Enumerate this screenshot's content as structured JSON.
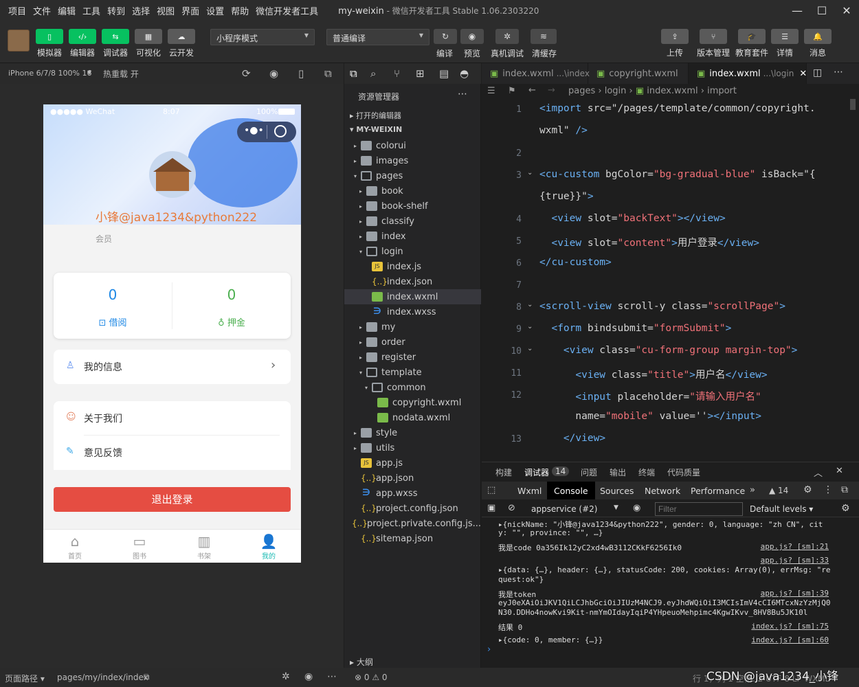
{
  "menu": [
    "项目",
    "文件",
    "编辑",
    "工具",
    "转到",
    "选择",
    "视图",
    "界面",
    "设置",
    "帮助",
    "微信开发者工具"
  ],
  "window": {
    "project": "my-weixin",
    "title": " - 微信开发者工具 Stable 1.06.2303220",
    "min": "—",
    "max": "☐",
    "close": "✕"
  },
  "toolbar": {
    "left_buttons": [
      {
        "label": "模拟器",
        "glyph": "▯"
      },
      {
        "label": "编辑器",
        "glyph": "‹/›"
      },
      {
        "label": "调试器",
        "glyph": "⇆"
      },
      {
        "label": "可视化",
        "glyph": "▦"
      },
      {
        "label": "云开发",
        "glyph": "☁"
      }
    ],
    "mode": "小程序模式",
    "compile": "普通编译",
    "mid_labels": [
      "编译",
      "预览",
      "真机调试",
      "清缓存"
    ],
    "mid_glyphs": [
      "↻",
      "◉",
      "✲",
      "≋"
    ],
    "right_buttons": [
      {
        "label": "上传",
        "glyph": "⇪"
      },
      {
        "label": "版本管理",
        "glyph": "⑂"
      },
      {
        "label": "教育套件",
        "glyph": "🎓"
      },
      {
        "label": "详情",
        "glyph": "☰"
      },
      {
        "label": "消息",
        "glyph": "🔔"
      }
    ]
  },
  "sim": {
    "device": "iPhone 6/7/8 100% 16",
    "reload": "热重载 开"
  },
  "phone": {
    "carrier": "●●●●● WeChat",
    "time": "8:07",
    "battery": "100%",
    "username": "小锋@java1234&python222",
    "role": "会员",
    "stats": [
      {
        "value": "0",
        "label": "借阅",
        "color": "#1e88e5"
      },
      {
        "value": "0",
        "label": "押金",
        "color": "#4caf50"
      }
    ],
    "my_info": "我的信息",
    "about": "关于我们",
    "feedback": "意见反馈",
    "logout": "退出登录",
    "nav": [
      {
        "label": "首页",
        "icon": "⌂"
      },
      {
        "label": "图书",
        "icon": "▭"
      },
      {
        "label": "书架",
        "icon": "▥"
      },
      {
        "label": "我的",
        "icon": "👤"
      }
    ]
  },
  "explorer": {
    "title": "资源管理器",
    "open_editors": "打开的编辑器",
    "root": "MY-WEIXIN",
    "items": [
      {
        "name": "colorui",
        "level": 1,
        "type": "folder"
      },
      {
        "name": "images",
        "level": 1,
        "type": "folder"
      },
      {
        "name": "pages",
        "level": 1,
        "type": "folder-open"
      },
      {
        "name": "book",
        "level": 2,
        "type": "folder"
      },
      {
        "name": "book-shelf",
        "level": 2,
        "type": "folder"
      },
      {
        "name": "classify",
        "level": 2,
        "type": "folder"
      },
      {
        "name": "index",
        "level": 2,
        "type": "folder"
      },
      {
        "name": "login",
        "level": 2,
        "type": "folder-open"
      },
      {
        "name": "index.js",
        "level": 3,
        "type": "js"
      },
      {
        "name": "index.json",
        "level": 3,
        "type": "json"
      },
      {
        "name": "index.wxml",
        "level": 3,
        "type": "wxml"
      },
      {
        "name": "index.wxss",
        "level": 3,
        "type": "wxss"
      },
      {
        "name": "my",
        "level": 2,
        "type": "folder"
      },
      {
        "name": "order",
        "level": 2,
        "type": "folder"
      },
      {
        "name": "register",
        "level": 2,
        "type": "folder"
      },
      {
        "name": "template",
        "level": 2,
        "type": "folder-open"
      },
      {
        "name": "common",
        "level": 3,
        "type": "folder-open"
      },
      {
        "name": "copyright.wxml",
        "level": 4,
        "type": "wxml"
      },
      {
        "name": "nodata.wxml",
        "level": 4,
        "type": "wxml"
      },
      {
        "name": "style",
        "level": 1,
        "type": "folder"
      },
      {
        "name": "utils",
        "level": 1,
        "type": "folder"
      },
      {
        "name": "app.js",
        "level": 1,
        "type": "js"
      },
      {
        "name": "app.json",
        "level": 1,
        "type": "json"
      },
      {
        "name": "app.wxss",
        "level": 1,
        "type": "wxss"
      },
      {
        "name": "project.config.json",
        "level": 1,
        "type": "json"
      },
      {
        "name": "project.private.config.js...",
        "level": 1,
        "type": "json"
      },
      {
        "name": "sitemap.json",
        "level": 1,
        "type": "json"
      }
    ],
    "outline": "大纲"
  },
  "editor": {
    "tabs": [
      {
        "name": "index.wxml",
        "dir": "...\\index"
      },
      {
        "name": "copyright.wxml",
        "dir": ""
      },
      {
        "name": "index.wxml",
        "dir": "...\\login"
      }
    ],
    "breadcrumb": [
      "pages",
      "login",
      "index.wxml",
      "import"
    ],
    "line_numbers": [
      "1",
      "",
      "2",
      "3",
      "",
      "4",
      "5",
      "6",
      "7",
      "8",
      "9",
      "10",
      "11",
      "12",
      "",
      "13"
    ],
    "lines": [
      "<import src=\"/pages/template/common/copyright.",
      "wxml\" />",
      "",
      "<cu-custom bgColor=\"bg-gradual-blue\" isBack=\"{",
      "{true}}\">",
      "  <view slot=\"backText\"></view>",
      "  <view slot=\"content\">用户登录</view>",
      "</cu-custom>",
      "",
      "<scroll-view scroll-y class=\"scrollPage\">",
      "  <form bindsubmit=\"formSubmit\">",
      "    <view class=\"cu-form-group margin-top\">",
      "      <view class=\"title\">用户名</view>",
      "      <input placeholder=\"请输入用户名\"",
      "      name=\"mobile\" value=''></input>",
      "    </view>"
    ]
  },
  "debug": {
    "top_tabs": [
      "构建",
      "调试器",
      "问题",
      "输出",
      "终端",
      "代码质量"
    ],
    "badge": "14",
    "dev_tabs": [
      "Wxml",
      "Console",
      "Sources",
      "Network",
      "Performance"
    ],
    "warn": "▲ 14",
    "context": "appservice (#2)",
    "filter_placeholder": "Filter",
    "levels": "Default levels ▾",
    "logs": [
      {
        "text": "▸{nickName: \"小锋@java1234&python222\", gender: 0, language: \"zh_CN\", cit",
        "src": ""
      },
      {
        "text": "  y: \"\", province: \"\", …}",
        "src": ""
      },
      {
        "text": "我是code 0a356Ik12yC2xd4wB3112CKkF6256Ik0",
        "src": "app.js? [sm]:21"
      },
      {
        "text": "",
        "src": "app.js? [sm]:33"
      },
      {
        "text": "▸{data: {…}, header: {…}, statusCode: 200, cookies: Array(0), errMsg: \"re",
        "src": ""
      },
      {
        "text": "  quest:ok\"}",
        "src": ""
      },
      {
        "text": "我是token",
        "src": "app.js? [sm]:39"
      },
      {
        "text": "eyJ0eXAiOiJKV1QiLCJhbGciOiJIUzM4NCJ9.eyJhdWQiOiI3MCIsImV4cCI6MTcxNzYzMjQ0",
        "src": ""
      },
      {
        "text": "N30.DDHo4nowKvi9Kit-nmYmOIdayIqiP4YHpeuoMehpimc4KgwIKvv_8HV8Bu5JK10l",
        "src": ""
      },
      {
        "text": "结果 0",
        "src": "index.js? [sm]:75"
      },
      {
        "text": "▸{code: 0, member: {…}}",
        "src": "index.js? [sm]:60"
      }
    ],
    "prompt": "›"
  },
  "status": {
    "path_label": "页面路径 ▾",
    "path": "pages/my/index/index",
    "errors": "⊗ 0 ⚠ 0",
    "right": "行 1，列 1  空格: 2  UTF-8  LF  WXML",
    "watermark": "CSDN @java1234_小锋"
  }
}
